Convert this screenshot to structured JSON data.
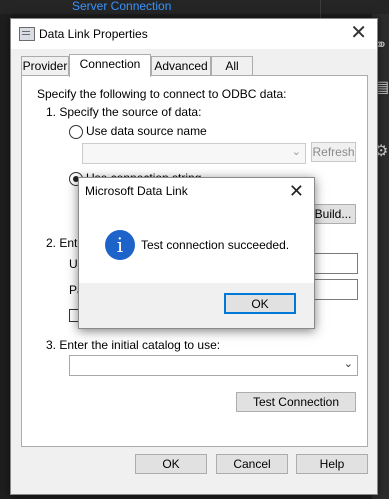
{
  "background": {
    "link": "Server Connection"
  },
  "dialog": {
    "title": "Data Link Properties",
    "tabs": [
      "Provider",
      "Connection",
      "Advanced",
      "All"
    ],
    "selected_tab": "Connection",
    "intro": "Specify the following to connect to ODBC data:",
    "step1": "1. Specify the source of data:",
    "use_dsn": "Use data source name",
    "refresh": "Refresh",
    "use_conn_string": "Use connection string",
    "build": "Build...",
    "step2_partial": "2. Ente",
    "user_partial": "U",
    "password_partial": "Pa",
    "step3": "3. Enter the initial catalog to use:",
    "test_connection": "Test Connection",
    "ok": "OK",
    "cancel": "Cancel",
    "help": "Help"
  },
  "message_box": {
    "title": "Microsoft Data Link",
    "icon": "info-icon",
    "text": "Test connection succeeded.",
    "ok": "OK"
  }
}
